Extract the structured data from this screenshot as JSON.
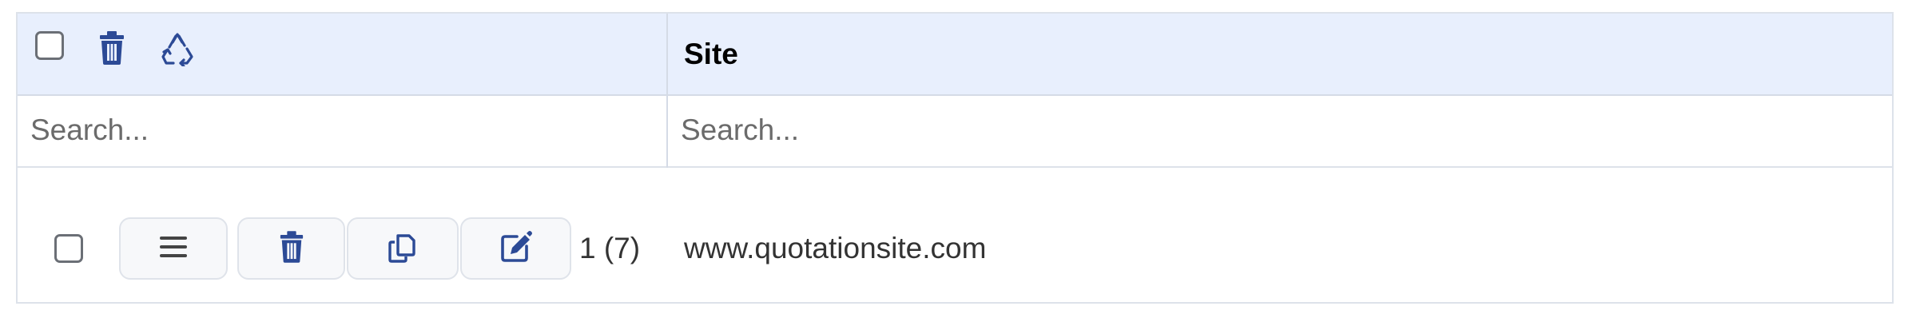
{
  "header": {
    "site_column_title": "Site",
    "icons": {
      "delete": "trash-icon",
      "recycle": "recycle-icon"
    }
  },
  "search": {
    "col1_placeholder": "Search...",
    "col2_placeholder": "Search..."
  },
  "rows": [
    {
      "count_label": "1 (7)",
      "site": "www.quotationsite.com",
      "buttons": [
        "menu-icon",
        "trash-icon",
        "copy-icon",
        "edit-icon"
      ]
    }
  ],
  "colors": {
    "header_bg": "#e8effd",
    "icon_blue": "#2c4a96",
    "border": "#dde2ea"
  }
}
